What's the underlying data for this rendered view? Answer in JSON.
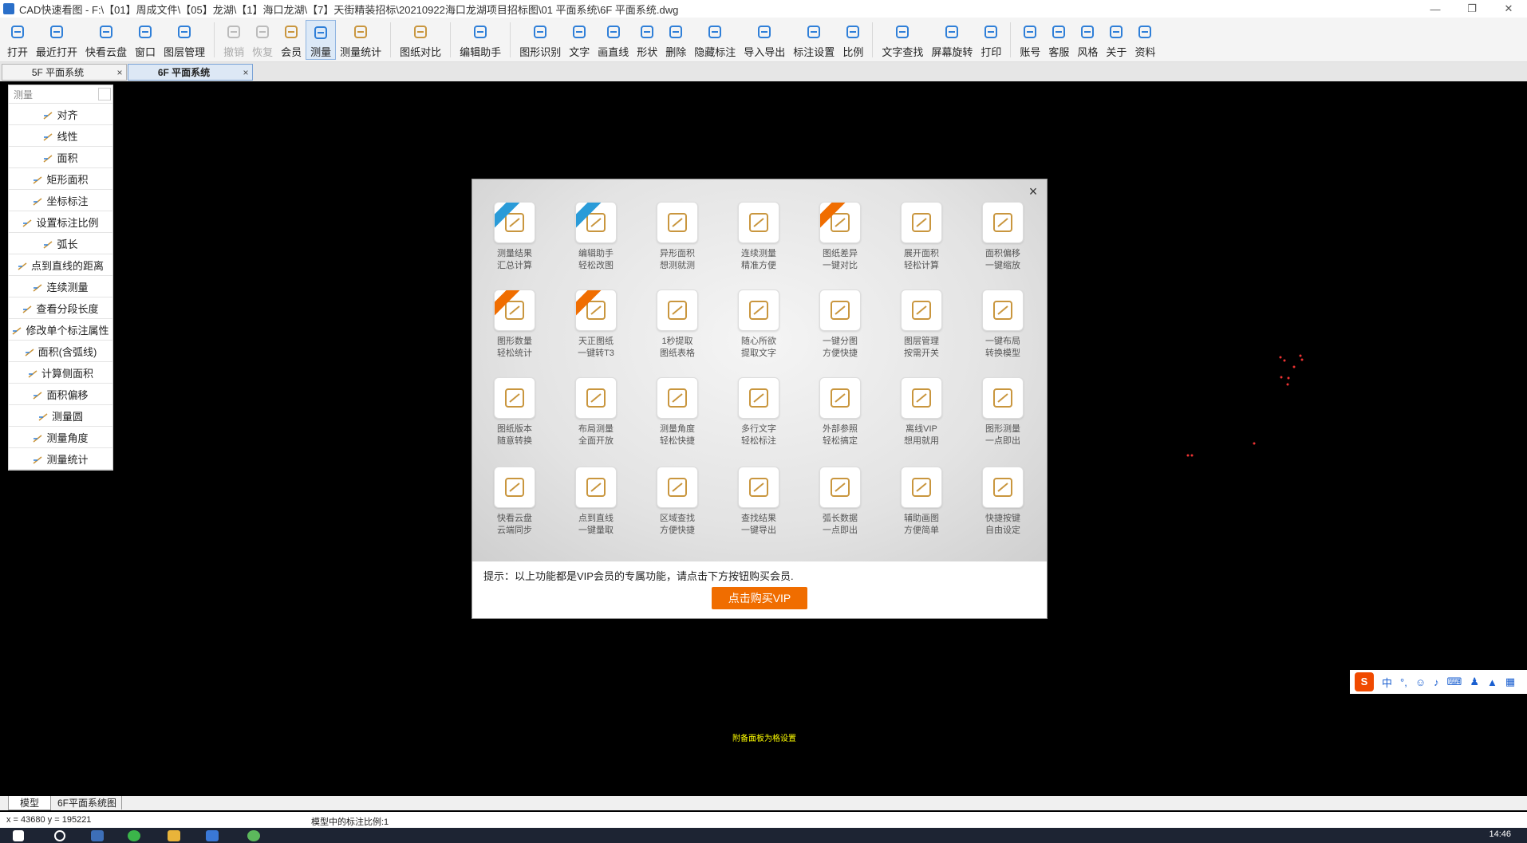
{
  "window": {
    "title": "CAD快速看图 - F:\\【01】周成文件\\【05】龙湖\\【1】海口龙湖\\【7】天街精装招标\\20210922海口龙湖项目招标图\\01 平面系统\\6F 平面系统.dwg"
  },
  "toolbar": {
    "buttons": [
      {
        "label": "打开",
        "icon": "open-folder-icon"
      },
      {
        "label": "最近打开",
        "icon": "history-icon"
      },
      {
        "label": "快看云盘",
        "icon": "cloud-icon"
      },
      {
        "label": "窗口",
        "icon": "window-icon"
      },
      {
        "label": "图层管理",
        "icon": "layers-icon"
      },
      {
        "label": "撤销",
        "icon": "undo-icon"
      },
      {
        "label": "恢复",
        "icon": "redo-icon"
      },
      {
        "label": "会员",
        "icon": "vip-icon"
      },
      {
        "label": "测量",
        "icon": "measure-icon"
      },
      {
        "label": "测量统计",
        "icon": "measure-stats-icon"
      },
      {
        "label": "图纸对比",
        "icon": "compare-icon"
      },
      {
        "label": "编辑助手",
        "icon": "edit-assistant-icon"
      },
      {
        "label": "图形识别",
        "icon": "shape-recognize-icon"
      },
      {
        "label": "文字",
        "icon": "text-icon"
      },
      {
        "label": "画直线",
        "icon": "line-icon"
      },
      {
        "label": "形状",
        "icon": "shape-icon"
      },
      {
        "label": "删除",
        "icon": "eraser-icon"
      },
      {
        "label": "隐藏标注",
        "icon": "hide-eye-icon"
      },
      {
        "label": "导入导出",
        "icon": "import-export-icon"
      },
      {
        "label": "标注设置",
        "icon": "annotation-settings-icon"
      },
      {
        "label": "比例",
        "icon": "scale-icon"
      },
      {
        "label": "文字查找",
        "icon": "text-search-icon"
      },
      {
        "label": "屏幕旋转",
        "icon": "rotate-screen-icon"
      },
      {
        "label": "打印",
        "icon": "print-icon"
      },
      {
        "label": "账号",
        "icon": "account-icon"
      },
      {
        "label": "客服",
        "icon": "headset-icon"
      },
      {
        "label": "风格",
        "icon": "style-icon"
      },
      {
        "label": "关于",
        "icon": "info-icon"
      },
      {
        "label": "资料",
        "icon": "docs-icon"
      }
    ]
  },
  "tabs": [
    {
      "label": "5F 平面系统",
      "close": "×"
    },
    {
      "label": "6F 平面系统",
      "close": "×"
    }
  ],
  "measure_panel": {
    "header": "测量",
    "items": [
      "对齐",
      "线性",
      "面积",
      "矩形面积",
      "坐标标注",
      "设置标注比例",
      "弧长",
      "点到直线的距离",
      "连续测量",
      "查看分段长度",
      "修改单个标注属性",
      "面积(含弧线)",
      "计算侧面积",
      "面积偏移",
      "测量圆",
      "测量角度",
      "测量统计"
    ]
  },
  "vip_dialog": {
    "close": "×",
    "features": [
      {
        "l1": "测量结果",
        "l2": "汇总计算",
        "badge": "new",
        "icon": "measure-summary-icon"
      },
      {
        "l1": "编辑助手",
        "l2": "轻松改图",
        "badge": "new",
        "icon": "cad-edit-icon"
      },
      {
        "l1": "异形面积",
        "l2": "想测就测",
        "badge": "",
        "icon": "irregular-area-icon"
      },
      {
        "l1": "连续测量",
        "l2": "精准方便",
        "badge": "",
        "icon": "continuous-measure-icon"
      },
      {
        "l1": "图纸差异",
        "l2": "一键对比",
        "badge": "hot",
        "icon": "diff-compare-icon"
      },
      {
        "l1": "展开面积",
        "l2": "轻松计算",
        "badge": "",
        "icon": "unfold-area-icon"
      },
      {
        "l1": "面积偏移",
        "l2": "一键缩放",
        "badge": "",
        "icon": "area-offset-icon"
      },
      {
        "l1": "图形数量",
        "l2": "轻松统计",
        "badge": "hot",
        "icon": "shape-count-icon"
      },
      {
        "l1": "天正图纸",
        "l2": "一键转T3",
        "badge": "hot",
        "icon": "tangent-convert-icon"
      },
      {
        "l1": "1秒提取",
        "l2": "图纸表格",
        "badge": "",
        "icon": "extract-table-icon"
      },
      {
        "l1": "随心所欲",
        "l2": "提取文字",
        "badge": "",
        "icon": "extract-text-icon"
      },
      {
        "l1": "一键分图",
        "l2": "方便快捷",
        "badge": "",
        "icon": "split-drawing-icon"
      },
      {
        "l1": "图层管理",
        "l2": "按需开关",
        "badge": "",
        "icon": "layer-toggle-icon"
      },
      {
        "l1": "一键布局",
        "l2": "转换模型",
        "badge": "",
        "icon": "layout-convert-icon"
      },
      {
        "l1": "图纸版本",
        "l2": "随意转换",
        "badge": "",
        "icon": "version-convert-icon"
      },
      {
        "l1": "布局测量",
        "l2": "全面开放",
        "badge": "",
        "icon": "layout-measure-icon"
      },
      {
        "l1": "测量角度",
        "l2": "轻松快捷",
        "badge": "",
        "icon": "angle-measure-icon"
      },
      {
        "l1": "多行文字",
        "l2": "轻松标注",
        "badge": "",
        "icon": "multiline-text-icon"
      },
      {
        "l1": "外部参照",
        "l2": "轻松搞定",
        "badge": "",
        "icon": "xref-icon"
      },
      {
        "l1": "离线VIP",
        "l2": "想用就用",
        "badge": "",
        "icon": "offline-vip-icon"
      },
      {
        "l1": "图形测量",
        "l2": "一点即出",
        "badge": "",
        "icon": "shape-measure-icon"
      },
      {
        "l1": "快看云盘",
        "l2": "云端同步",
        "badge": "",
        "icon": "cloud-sync-icon"
      },
      {
        "l1": "点到直线",
        "l2": "一键量取",
        "badge": "",
        "icon": "point-line-icon"
      },
      {
        "l1": "区域查找",
        "l2": "方便快捷",
        "badge": "",
        "icon": "area-search-icon"
      },
      {
        "l1": "查找结果",
        "l2": "一键导出",
        "badge": "",
        "icon": "export-results-icon"
      },
      {
        "l1": "弧长数据",
        "l2": "一点即出",
        "badge": "",
        "icon": "arc-length-icon"
      },
      {
        "l1": "辅助画图",
        "l2": "方便简单",
        "badge": "",
        "icon": "draw-assist-icon"
      },
      {
        "l1": "快捷按键",
        "l2": "自由设定",
        "badge": "",
        "icon": "shortcut-keys-icon"
      }
    ],
    "hint": "提示：以上功能都是VIP会员的专属功能，请点击下方按钮购买会员.",
    "buy_button": "点击购买VIP"
  },
  "canvas": {
    "yellow_text": "附备面板为格设置"
  },
  "ime": {
    "lang": "中",
    "punct": "°,"
  },
  "model_tabs": [
    "模型",
    "6F平面系统图"
  ],
  "status": {
    "coords": "x = 43680  y = 195221",
    "scale_text": "模型中的标注比例:1"
  },
  "taskbar": {
    "clock": "14:46"
  },
  "colors": {
    "accent": "#f06d00",
    "toolbar_icon": "#2f7fd8",
    "gold_icon": "#c9963e",
    "badge_blue": "#2a9bd8",
    "badge_orange": "#f06d00"
  }
}
